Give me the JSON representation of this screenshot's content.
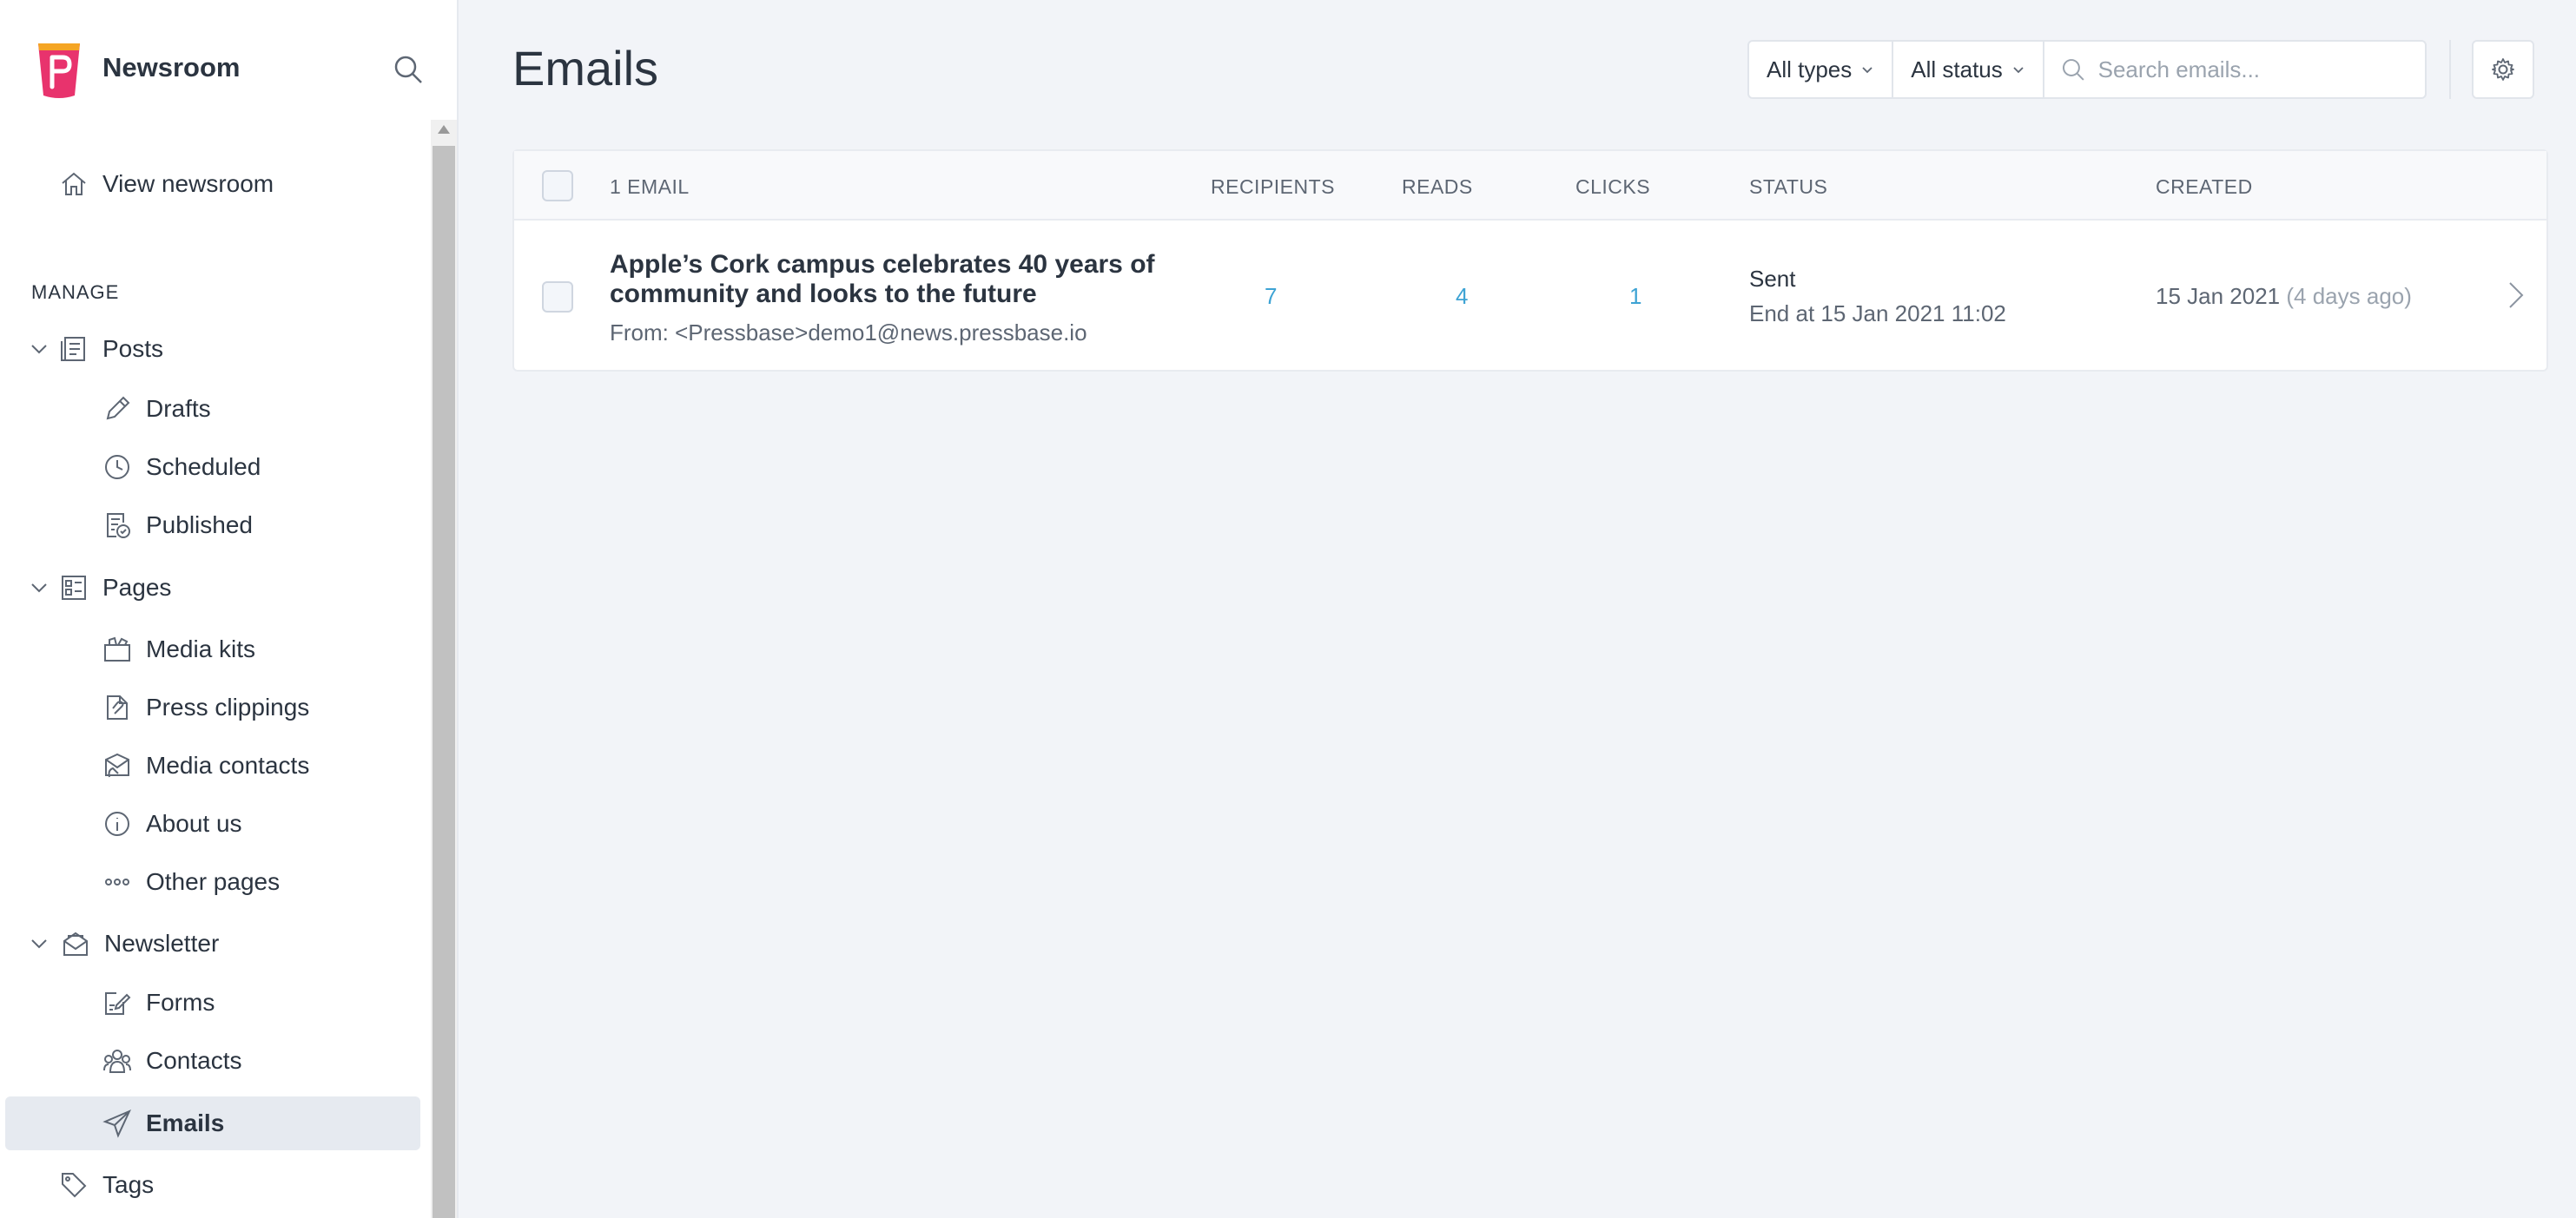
{
  "sidebar": {
    "brand": "Newsroom",
    "view_newsroom": "View newsroom",
    "manage_label": "MANAGE",
    "items": {
      "posts": "Posts",
      "drafts": "Drafts",
      "scheduled": "Scheduled",
      "published": "Published",
      "pages": "Pages",
      "media_kits": "Media kits",
      "press_clippings": "Press clippings",
      "media_contacts": "Media contacts",
      "about_us": "About us",
      "other_pages": "Other pages",
      "newsletter": "Newsletter",
      "forms": "Forms",
      "contacts": "Contacts",
      "emails": "Emails",
      "tags": "Tags"
    },
    "active": "emails"
  },
  "header": {
    "title": "Emails",
    "filter_type": "All types",
    "filter_status": "All status",
    "search_placeholder": "Search emails..."
  },
  "table": {
    "columns": {
      "count": "1 EMAIL",
      "recipients": "RECIPIENTS",
      "reads": "READS",
      "clicks": "CLICKS",
      "status": "STATUS",
      "created": "CREATED"
    },
    "rows": [
      {
        "title": "Apple’s Cork campus celebrates 40 years of community and looks to the future",
        "from": "From: <Pressbase>demo1@news.pressbase.io",
        "recipients": "7",
        "reads": "4",
        "clicks": "1",
        "status": "Sent",
        "status_detail": "End at 15 Jan 2021 11:02",
        "created": "15 Jan 2021",
        "created_ago": "(4 days ago)"
      }
    ]
  },
  "colors": {
    "accent": "#3da3d4",
    "text": "#2b3440",
    "muted": "#5d6673",
    "background": "#f2f4f8",
    "logo_pink": "#e8336d",
    "logo_orange": "#f5a524"
  }
}
